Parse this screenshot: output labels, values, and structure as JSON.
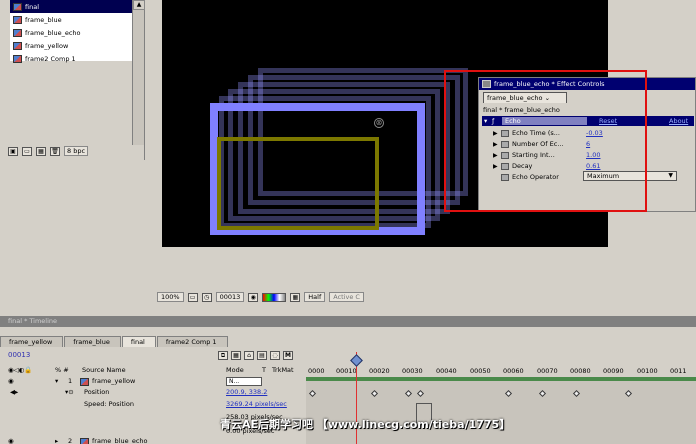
{
  "project": {
    "items": [
      {
        "label": "final",
        "selected": true
      },
      {
        "label": "frame_blue",
        "selected": false
      },
      {
        "label": "frame_blue_echo",
        "selected": false
      },
      {
        "label": "frame_yellow",
        "selected": false
      },
      {
        "label": "frame2 Comp 1",
        "selected": false
      }
    ],
    "bpc_label": "8 bpc"
  },
  "comp_viewer": {
    "zoom": "100%",
    "timecode": "00013",
    "resolution": "Half",
    "camera": "Active C"
  },
  "effect_controls": {
    "title": "frame_blue_echo * Effect Controls",
    "tab_label": "frame_blue_echo",
    "target": "final * frame_blue_echo",
    "effect_name": "Echo",
    "reset_label": "Reset",
    "about_label": "About",
    "params": [
      {
        "label": "Echo Time (s...",
        "value": "-0.03"
      },
      {
        "label": "Number Of Ec...",
        "value": "6"
      },
      {
        "label": "Starting Int...",
        "value": "1.00"
      },
      {
        "label": "Decay",
        "value": "0.61"
      },
      {
        "label": "Echo Operator",
        "value": "Maximum"
      }
    ]
  },
  "timeline": {
    "window_title": "final * Timeline",
    "tabs": [
      "frame_yellow",
      "frame_blue",
      "final",
      "frame2 Comp 1"
    ],
    "current_time": "00013",
    "columns": {
      "source_name": "Source Name",
      "mode": "Mode",
      "t": "T",
      "trkmat": "TrkMat"
    },
    "ruler_ticks": [
      "0000",
      "00010",
      "00020",
      "00030",
      "00040",
      "00050",
      "00060",
      "00070",
      "00080",
      "00090",
      "00100",
      "0011"
    ],
    "layers": [
      {
        "index": "1",
        "name": "frame_yellow",
        "mode": "N..."
      },
      {
        "index": "2",
        "name": "frame_blue_echo",
        "mode": ""
      }
    ],
    "position_label": "Position",
    "position_value": "200.9, 338.2",
    "speed_label": "Speed: Position",
    "speed_value": "3269.24 pixels/sec",
    "speed_value2": "258.03 pixels/sec",
    "speed_value3": "0.00 pixels/sec"
  },
  "watermark": "青云AE后期学习吧 【www.linecg.com/tieba/1775】",
  "colors": {
    "accent": "#000070",
    "highlight": "#e01010",
    "layer_blue": "#8080ff",
    "layer_yellow": "#7c7800"
  }
}
